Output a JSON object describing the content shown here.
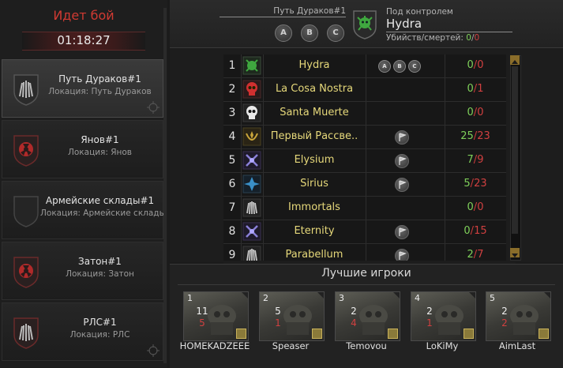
{
  "battle": {
    "title": "Идет бой",
    "timer": "01:18:27"
  },
  "locations": [
    {
      "name": "Путь Дураков#1",
      "sub": "Локация: Путь Дураков",
      "active": true
    },
    {
      "name": "Янов#1",
      "sub": "Локация: Янов",
      "active": false
    },
    {
      "name": "Армейские склады#1",
      "sub": "Локация: Армейские склады",
      "active": false
    },
    {
      "name": "Затон#1",
      "sub": "Локация: Затон",
      "active": false
    },
    {
      "name": "РЛС#1",
      "sub": "Локация: РЛС",
      "active": false
    }
  ],
  "header": {
    "location_title": "Путь Дураков#1",
    "points": [
      "A",
      "B",
      "C"
    ],
    "control_label": "Под контролем",
    "control_name": "Hydra",
    "stats_label": "Убийств/смертей:",
    "kills": "0",
    "deaths": "0"
  },
  "clans": [
    {
      "rank": "1",
      "name": "Hydra",
      "icon": "hydra-icon",
      "flags": "abc",
      "kills": "0",
      "deaths": "0"
    },
    {
      "rank": "2",
      "name": "La Cosa Nostra",
      "icon": "red-skull-icon",
      "flags": "",
      "kills": "0",
      "deaths": "1"
    },
    {
      "rank": "3",
      "name": "Santa Muerte",
      "icon": "white-skull-icon",
      "flags": "",
      "kills": "0",
      "deaths": "0"
    },
    {
      "rank": "4",
      "name": "Первый Рассве..",
      "icon": "gold-wreath-icon",
      "flags": "flag",
      "kills": "25",
      "deaths": "23"
    },
    {
      "rank": "5",
      "name": "Elysium",
      "icon": "purple-swords-icon",
      "flags": "flag",
      "kills": "7",
      "deaths": "9"
    },
    {
      "rank": "6",
      "name": "Sirius",
      "icon": "blue-star-icon",
      "flags": "flag",
      "kills": "5",
      "deaths": "23"
    },
    {
      "rank": "7",
      "name": "Immortals",
      "icon": "silver-wings-icon",
      "flags": "",
      "kills": "0",
      "deaths": "0"
    },
    {
      "rank": "8",
      "name": "Eternity",
      "icon": "purple-swords-icon",
      "flags": "flag",
      "kills": "0",
      "deaths": "15"
    },
    {
      "rank": "9",
      "name": "Parabellum",
      "icon": "silver-wings-icon",
      "flags": "flag",
      "kills": "2",
      "deaths": "7"
    }
  ],
  "best_players": {
    "title": "Лучшие игроки",
    "players": [
      {
        "rank": "1",
        "kills": "11",
        "deaths": "5",
        "name": "HOMEKADZEEE"
      },
      {
        "rank": "2",
        "kills": "5",
        "deaths": "1",
        "name": "Speaser"
      },
      {
        "rank": "3",
        "kills": "2",
        "deaths": "4",
        "name": "Temovou"
      },
      {
        "rank": "4",
        "kills": "2",
        "deaths": "1",
        "name": "LoKiMy"
      },
      {
        "rank": "5",
        "kills": "2",
        "deaths": "2",
        "name": "AimLast"
      }
    ]
  },
  "colors": {
    "accent_red": "#d03a32",
    "kill_green": "#7fd05a",
    "death_red": "#d04040",
    "clan_yellow": "#e6d87a"
  }
}
